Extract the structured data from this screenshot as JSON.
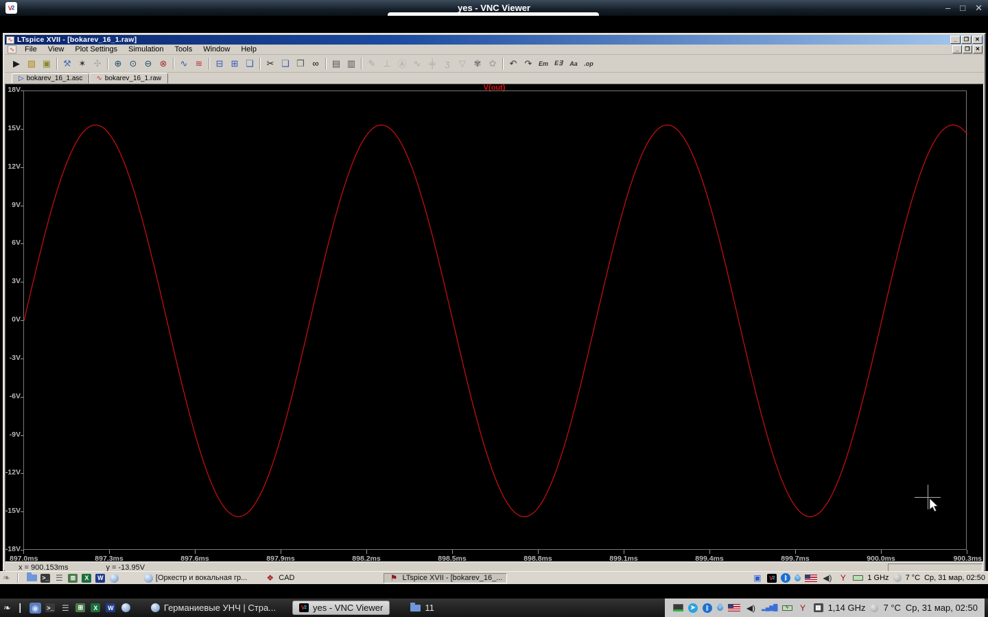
{
  "vnc_viewer": {
    "title": "yes - VNC Viewer",
    "logo": "V2",
    "controls": [
      {
        "name": "minimize-button",
        "glyph": "–"
      },
      {
        "name": "maximize-button",
        "glyph": "□"
      },
      {
        "name": "close-button",
        "glyph": "✕"
      }
    ]
  },
  "ltspice": {
    "title": "LTspice XVII - [bokarev_16_1.raw]",
    "menus": [
      "File",
      "View",
      "Plot Settings",
      "Simulation",
      "Tools",
      "Window",
      "Help"
    ],
    "title_controls": [
      {
        "name": "minimize-button",
        "glyph": "_"
      },
      {
        "name": "restore-button",
        "glyph": "❐"
      },
      {
        "name": "close-button",
        "glyph": "✕"
      }
    ],
    "child_controls": [
      {
        "name": "child-minimize-button",
        "glyph": "_"
      },
      {
        "name": "child-restore-button",
        "glyph": "❐"
      },
      {
        "name": "child-close-button",
        "glyph": "✕"
      }
    ],
    "toolbar": [
      {
        "name": "new-file",
        "glyph": "▶",
        "color": "#1a1a1a"
      },
      {
        "name": "open-file",
        "glyph": "▨",
        "color": "#b08820"
      },
      {
        "name": "save",
        "glyph": "▣",
        "color": "#8a8a2a"
      },
      {
        "sep": true
      },
      {
        "name": "control-panel-hammer",
        "glyph": "⚒",
        "color": "#4a6fb5"
      },
      {
        "name": "run-simulation",
        "glyph": "✶",
        "color": "#333333"
      },
      {
        "name": "halt-simulation",
        "glyph": "✣",
        "color": "#aaaaaa",
        "disabled": true
      },
      {
        "sep": true
      },
      {
        "name": "zoom-in",
        "glyph": "⊕",
        "color": "#1a4a6a"
      },
      {
        "name": "zoom-fit",
        "glyph": "⊙",
        "color": "#1a4a6a"
      },
      {
        "name": "zoom-out",
        "glyph": "⊖",
        "color": "#1a4a6a"
      },
      {
        "name": "zoom-full-extents",
        "glyph": "⊗",
        "color": "#a03030"
      },
      {
        "sep": true
      },
      {
        "name": "autorange-y-axis",
        "glyph": "∿",
        "color": "#3355bb"
      },
      {
        "name": "plot-settings-pane",
        "glyph": "≋",
        "color": "#bb3333"
      },
      {
        "sep": true
      },
      {
        "name": "tile-horizontally",
        "glyph": "⊟",
        "color": "#3355bb"
      },
      {
        "name": "tile-vertically",
        "glyph": "⊞",
        "color": "#3355bb"
      },
      {
        "name": "cascade-windows",
        "glyph": "❏",
        "color": "#3355bb"
      },
      {
        "sep": true
      },
      {
        "name": "cut",
        "glyph": "✂",
        "color": "#222222"
      },
      {
        "name": "copy",
        "glyph": "❑",
        "color": "#3355bb"
      },
      {
        "name": "paste",
        "glyph": "❒",
        "color": "#555555"
      },
      {
        "name": "find",
        "glyph": "∞",
        "color": "#111111"
      },
      {
        "sep": true
      },
      {
        "name": "print",
        "glyph": "▤",
        "color": "#555555"
      },
      {
        "name": "print-preview",
        "glyph": "▥",
        "color": "#555555"
      },
      {
        "sep": true
      },
      {
        "name": "edit-pencil",
        "glyph": "✎",
        "color": "#aaaaaa",
        "disabled": true
      },
      {
        "name": "ground",
        "glyph": "⊥",
        "color": "#aaaaaa",
        "disabled": true
      },
      {
        "name": "net-label",
        "glyph": "Ⓐ",
        "color": "#aaaaaa",
        "disabled": true
      },
      {
        "name": "resistor",
        "glyph": "∿",
        "color": "#aaaaaa",
        "disabled": true
      },
      {
        "name": "capacitor",
        "glyph": "╪",
        "color": "#aaaaaa",
        "disabled": true
      },
      {
        "name": "inductor",
        "glyph": "ʒ",
        "color": "#aaaaaa",
        "disabled": true
      },
      {
        "name": "diode",
        "glyph": "▽",
        "color": "#aaaaaa",
        "disabled": true
      },
      {
        "name": "component",
        "glyph": "✾",
        "color": "#777777",
        "disabled": true
      },
      {
        "name": "component-alt",
        "glyph": "✿",
        "color": "#aaaaaa",
        "disabled": true
      },
      {
        "sep": true
      },
      {
        "name": "undo",
        "glyph": "↶",
        "color": "#333333"
      },
      {
        "name": "redo",
        "glyph": "↷",
        "color": "#333333"
      },
      {
        "name": "label-em",
        "glyph": "Em",
        "color": "#333333",
        "text": true
      },
      {
        "name": "label-e3",
        "glyph": "E∃",
        "color": "#333333",
        "text": true
      },
      {
        "name": "add-text",
        "glyph": "Aa",
        "color": "#333333",
        "text": true
      },
      {
        "name": "spice-directive",
        "glyph": ".op",
        "color": "#333333",
        "text": true
      }
    ],
    "tabs": [
      {
        "label": "bokarev_16_1.asc",
        "icon_glyph": "▷",
        "icon_color": "#2244cc",
        "active": false
      },
      {
        "label": "bokarev_16_1.raw",
        "icon_glyph": "∿",
        "icon_color": "#c03030",
        "active": true
      }
    ],
    "status_bar": {
      "x_readout": "x = 900.153ms",
      "y_readout": "y = -13.95V"
    }
  },
  "chart_data": {
    "type": "line",
    "title": "V(out)",
    "trace_color": "#d01010",
    "x_unit": "ms",
    "x_range_ms": [
      897.0,
      900.3
    ],
    "x_ticks": [
      "897.0ms",
      "897.3ms",
      "897.6ms",
      "897.9ms",
      "898.2ms",
      "898.5ms",
      "898.8ms",
      "899.1ms",
      "899.4ms",
      "899.7ms",
      "900.0ms",
      "900.3ms"
    ],
    "y_range_V": [
      -18,
      18
    ],
    "y_ticks": [
      "18V",
      "15V",
      "12V",
      "9V",
      "6V",
      "3V",
      "0V",
      "-3V",
      "-6V",
      "-9V",
      "-12V",
      "-15V",
      "-18V"
    ],
    "grid": false,
    "legend_position": "top-center",
    "signal": {
      "shape": "sine",
      "amplitude_V": 15.35,
      "offset_V": 0,
      "period_ms": 1.0,
      "phase_zero_at_ms": 897.0
    },
    "series": [
      {
        "name": "V(out)",
        "x_ms": [
          897.0,
          897.25,
          897.5,
          897.75,
          898.0,
          898.25,
          898.5,
          898.75,
          899.0,
          899.25,
          899.5,
          899.75,
          900.0,
          900.25,
          900.3
        ],
        "y_V": [
          0,
          15.35,
          0,
          -15.35,
          0,
          15.35,
          0,
          -15.35,
          0,
          15.35,
          0,
          -15.35,
          0,
          15.35,
          14.6
        ]
      }
    ],
    "cursor": {
      "x_ms": 900.153,
      "y_V": -13.95
    }
  },
  "inner_taskbar": {
    "quick_launch": [
      {
        "name": "gnome-menu-foot-icon",
        "type": "paw",
        "color": "#7a7a7a"
      },
      {
        "name": "separator",
        "type": "sep"
      },
      {
        "name": "file-manager-icon",
        "type": "folder"
      },
      {
        "name": "terminal-icon",
        "type": "letterbox",
        "bg": "#3a3a3a",
        "glyph": ">_"
      },
      {
        "name": "archive-icon",
        "type": "glyph",
        "glyph": "☰",
        "color": "#5a5a5a"
      },
      {
        "name": "calculator-icon",
        "type": "letterbox",
        "bg": "#4a7a4a",
        "glyph": "⊞"
      },
      {
        "name": "excel-icon",
        "type": "letterbox",
        "bg": "#1a6e3c",
        "glyph": "X"
      },
      {
        "name": "word-icon",
        "type": "letterbox",
        "bg": "#1f3b8c",
        "glyph": "W"
      },
      {
        "name": "globe-icon",
        "type": "globe"
      }
    ],
    "tasks": [
      {
        "name": "browser-task",
        "icon": {
          "type": "globe"
        },
        "label": "[Оркестр и вокальная гр...",
        "active": false,
        "gap": 26
      },
      {
        "name": "cad-task",
        "icon": {
          "type": "glyph",
          "glyph": "❖",
          "color": "#a02020"
        },
        "label": "CAD",
        "active": false,
        "gap": 10
      },
      {
        "name": "ltspice-task",
        "icon": {
          "type": "glyph",
          "glyph": "⚑",
          "color": "#8b1a1a"
        },
        "label": "LTspice XVII - [bokarev_16_...",
        "active": true,
        "gap": 120
      }
    ],
    "tray": [
      {
        "name": "save-indicator-icon",
        "type": "glyph",
        "glyph": "▣",
        "color": "#2a5fd4"
      },
      {
        "name": "vnc-server-icon",
        "type": "vncbox",
        "glyph": "V2"
      },
      {
        "name": "bluetooth-icon",
        "type": "circle",
        "bg": "#1a6fd4",
        "glyph": "ᛒ"
      },
      {
        "name": "water-drop-icon",
        "type": "drop"
      },
      {
        "name": "us-flag-icon",
        "type": "flag"
      },
      {
        "name": "speaker-icon",
        "type": "glyph",
        "glyph": "◀)",
        "color": "#333333"
      },
      {
        "name": "wine-glass-icon",
        "type": "glyph",
        "glyph": "Y",
        "color": "#a01010"
      },
      {
        "name": "battery-icon",
        "type": "battery",
        "glyph": ""
      },
      {
        "name": "cpu-frequency-text",
        "type": "text",
        "label": "1  GHz"
      },
      {
        "name": "weather-moon-icon",
        "type": "moon"
      },
      {
        "name": "temperature-text",
        "type": "text",
        "label": "7 °C"
      },
      {
        "name": "clock-text",
        "type": "text",
        "label": "Ср, 31 мар, 02:50"
      }
    ]
  },
  "outer_taskbar": {
    "quick_launch": [
      {
        "name": "gnome-menu-foot-icon",
        "type": "paw",
        "color": "#e8e8e8"
      },
      {
        "name": "separator",
        "type": "sep"
      },
      {
        "name": "screenshot-tool-icon",
        "type": "glyph",
        "glyph": "◉",
        "color": "#cfe0ff",
        "pressed": true
      },
      {
        "name": "terminal-icon",
        "type": "letterbox",
        "bg": "#3a3a3a",
        "glyph": ">_"
      },
      {
        "name": "archive-icon",
        "type": "glyph",
        "glyph": "☰",
        "color": "#c0c0c0"
      },
      {
        "name": "calculator-icon",
        "type": "letterbox",
        "bg": "#4a7a4a",
        "glyph": "⊞"
      },
      {
        "name": "excel-icon",
        "type": "letterbox",
        "bg": "#1a6e3c",
        "glyph": "X"
      },
      {
        "name": "word-icon",
        "type": "letterbox",
        "bg": "#1f3b8c",
        "glyph": "W"
      },
      {
        "name": "globe-icon",
        "type": "globe"
      }
    ],
    "tasks": [
      {
        "name": "browser-task",
        "icon": {
          "type": "globe"
        },
        "label": "Германиевые УНЧ | Стра...",
        "active": false,
        "gap": 14
      },
      {
        "name": "vnc-viewer-task",
        "icon": {
          "type": "vncbox",
          "glyph": "V2"
        },
        "label": "yes - VNC Viewer",
        "active": true,
        "gap": 10
      },
      {
        "name": "folder-11-task",
        "icon": {
          "type": "folder"
        },
        "label": "11",
        "active": false,
        "gap": 16
      }
    ],
    "tray": [
      {
        "name": "display-icon",
        "type": "display"
      },
      {
        "name": "telegram-icon",
        "type": "circle",
        "bg": "#2aa3e0",
        "glyph": "➤"
      },
      {
        "name": "bluetooth-icon",
        "type": "circle",
        "bg": "#1a6fd4",
        "glyph": "ᛒ"
      },
      {
        "name": "water-drop-icon",
        "type": "drop"
      },
      {
        "name": "us-flag-icon",
        "type": "flag"
      },
      {
        "name": "speaker-icon",
        "type": "glyph",
        "glyph": "◀)",
        "color": "#222222"
      },
      {
        "name": "signal-bars-icon",
        "type": "signal",
        "glyph": "▂▄▆█"
      },
      {
        "name": "battery-charging-icon",
        "type": "battery",
        "glyph": "ϟ"
      },
      {
        "name": "wine-glass-icon",
        "type": "glyph",
        "glyph": "Y",
        "color": "#a01010"
      },
      {
        "name": "cpu-meter-icon",
        "type": "letterbox",
        "bg": "#4a4a4a",
        "glyph": "▦"
      },
      {
        "name": "cpu-frequency-text",
        "type": "text",
        "label": "1,14 GHz"
      },
      {
        "name": "weather-moon-icon",
        "type": "moon"
      },
      {
        "name": "temperature-text",
        "type": "text",
        "label": "7 °C"
      },
      {
        "name": "clock-text",
        "type": "text",
        "label": "Ср, 31 мар, 02:50"
      }
    ]
  }
}
